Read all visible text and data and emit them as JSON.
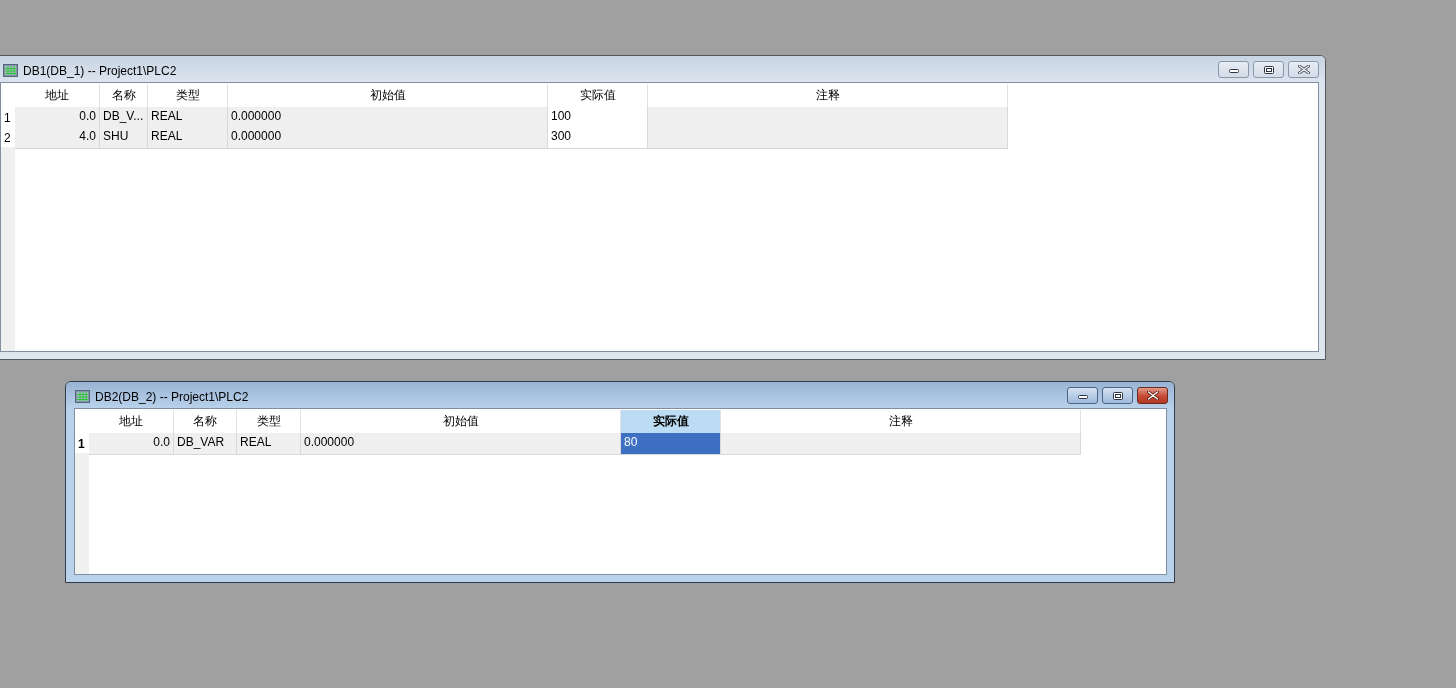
{
  "windows": [
    {
      "title": "DB1(DB_1) -- Project1\\PLC2",
      "active": false,
      "columns": [
        {
          "label": "地址",
          "selected": false,
          "editable": false
        },
        {
          "label": "名称",
          "selected": false,
          "editable": false
        },
        {
          "label": "类型",
          "selected": false,
          "editable": false
        },
        {
          "label": "初始值",
          "selected": false,
          "editable": false
        },
        {
          "label": "实际值",
          "selected": false,
          "editable": true
        },
        {
          "label": "注释",
          "selected": false,
          "editable": false
        }
      ],
      "rows": [
        {
          "number": "1",
          "selected": false,
          "cells": [
            "0.0",
            "DB_V...",
            "REAL",
            "0.000000",
            "100"
          ]
        },
        {
          "number": "2",
          "selected": false,
          "cells": [
            "4.0",
            "SHU",
            "REAL",
            "0.000000",
            "300"
          ]
        }
      ]
    },
    {
      "title": "DB2(DB_2) -- Project1\\PLC2",
      "active": true,
      "columns": [
        {
          "label": "地址",
          "selected": false,
          "editable": false
        },
        {
          "label": "名称",
          "selected": false,
          "editable": false
        },
        {
          "label": "类型",
          "selected": false,
          "editable": false
        },
        {
          "label": "初始值",
          "selected": false,
          "editable": false
        },
        {
          "label": "实际值",
          "selected": true,
          "editable": true
        },
        {
          "label": "注释",
          "selected": false,
          "editable": false
        }
      ],
      "rows": [
        {
          "number": "1",
          "selected": true,
          "cells": [
            "0.0",
            "DB_VAR",
            "REAL",
            "0.000000",
            "80"
          ]
        }
      ]
    }
  ]
}
